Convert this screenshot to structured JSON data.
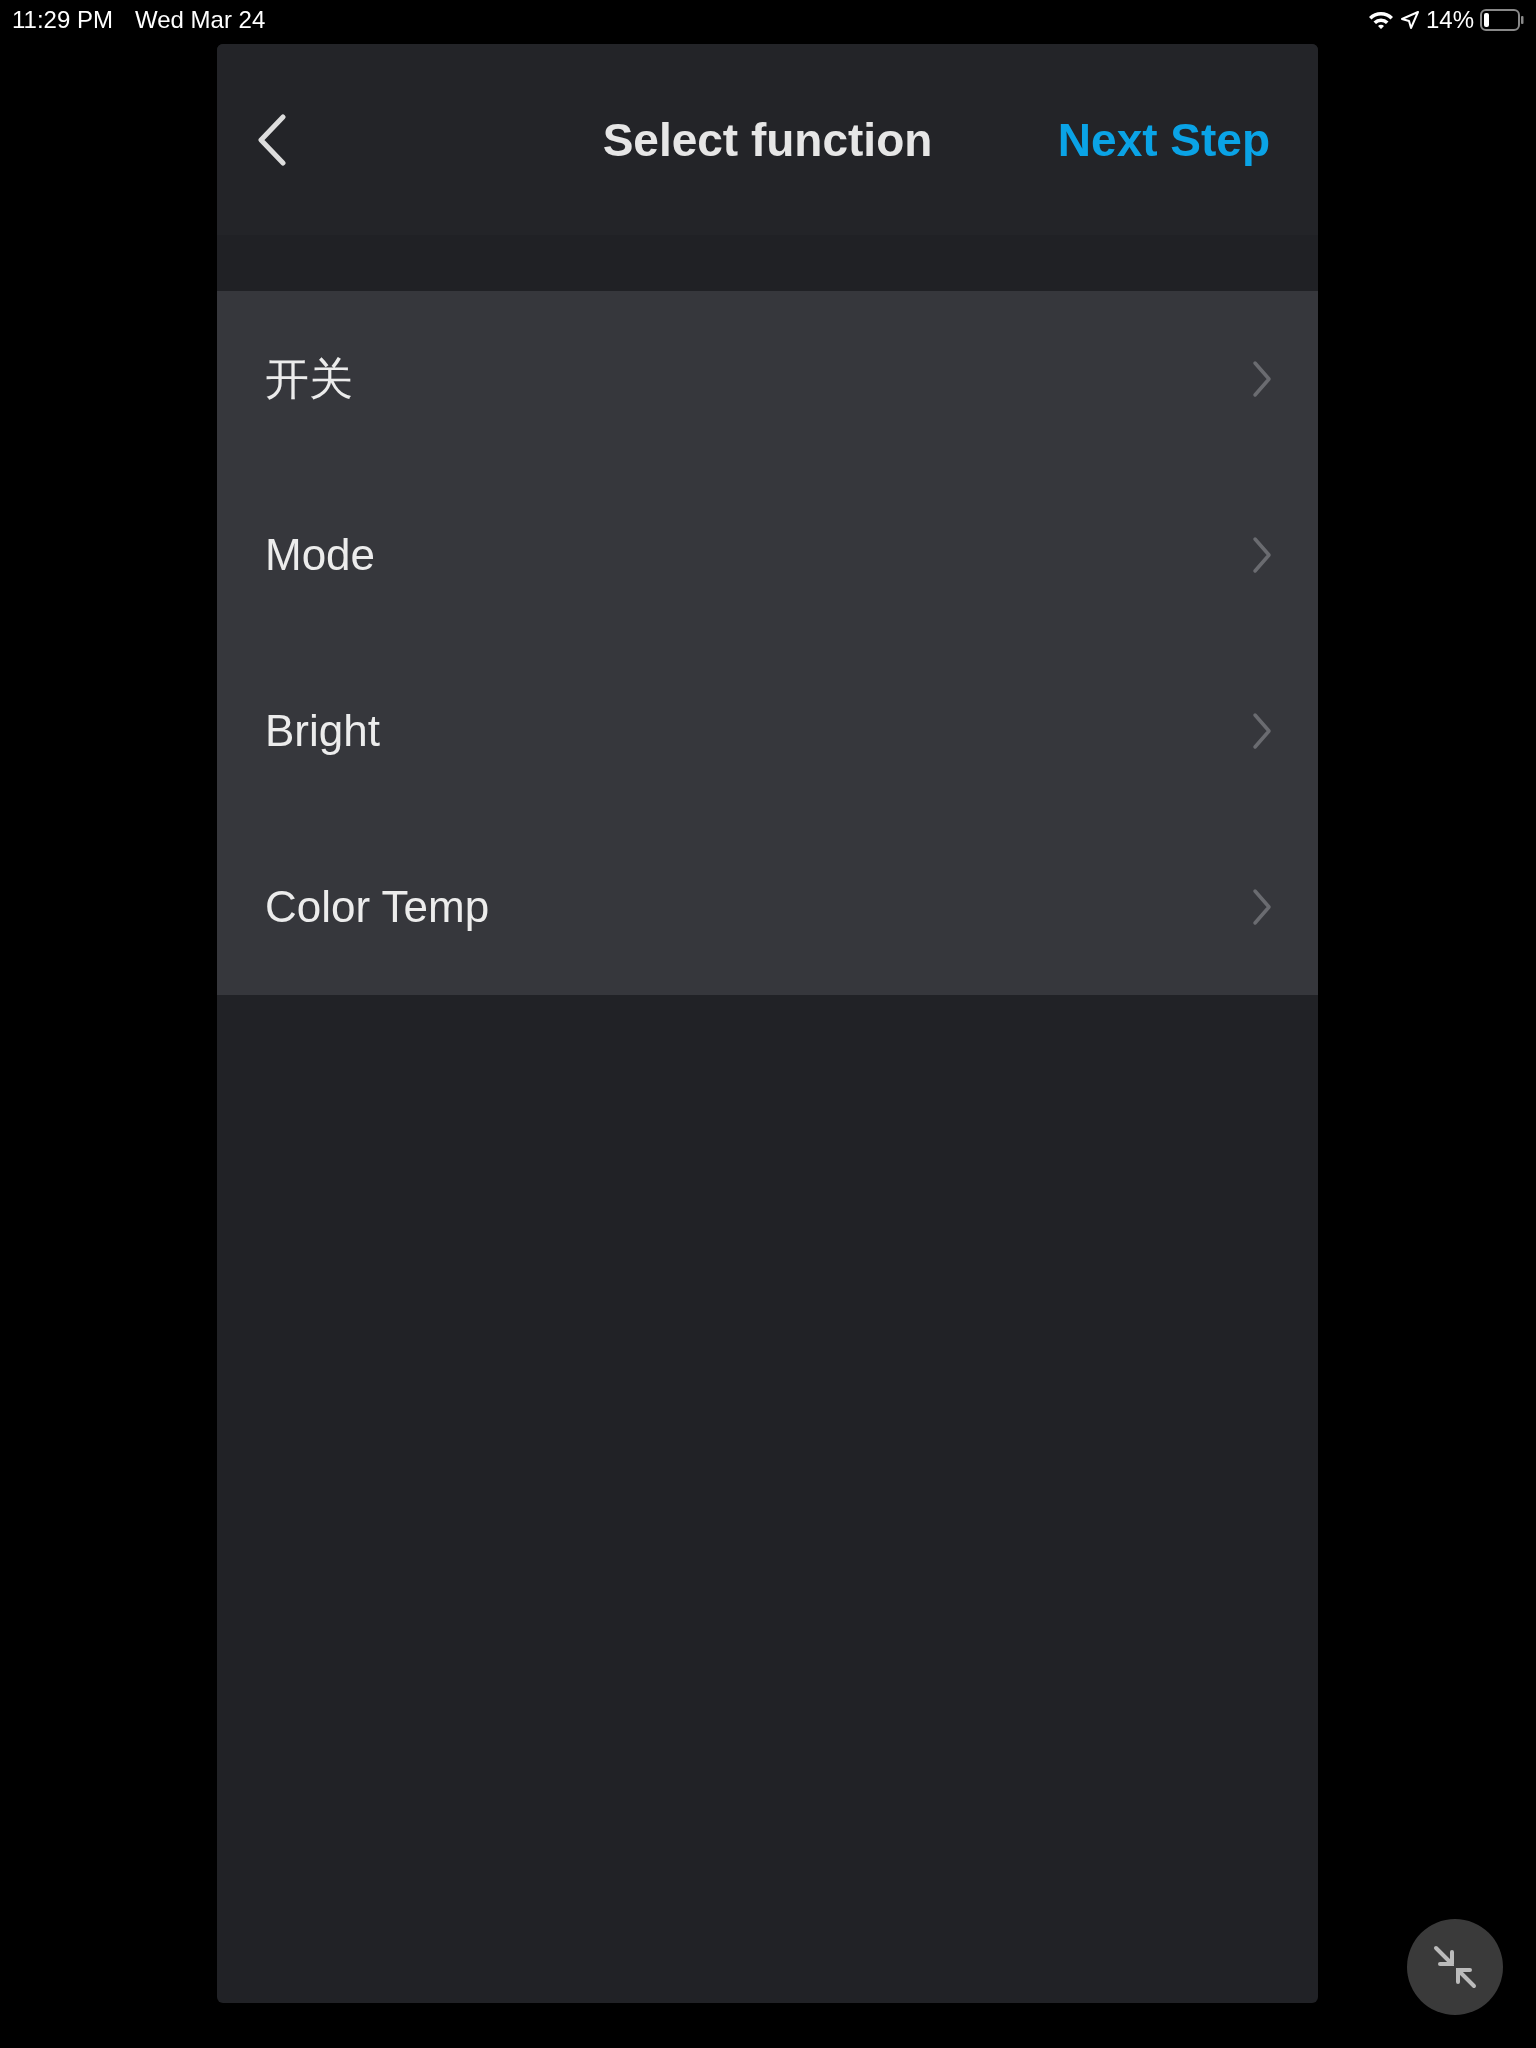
{
  "status_bar": {
    "time": "11:29 PM",
    "date": "Wed Mar 24",
    "battery": "14%"
  },
  "header": {
    "title": "Select function",
    "action": "Next Step"
  },
  "functions": [
    {
      "label": "开关"
    },
    {
      "label": "Mode"
    },
    {
      "label": "Bright"
    },
    {
      "label": "Color Temp"
    }
  ]
}
